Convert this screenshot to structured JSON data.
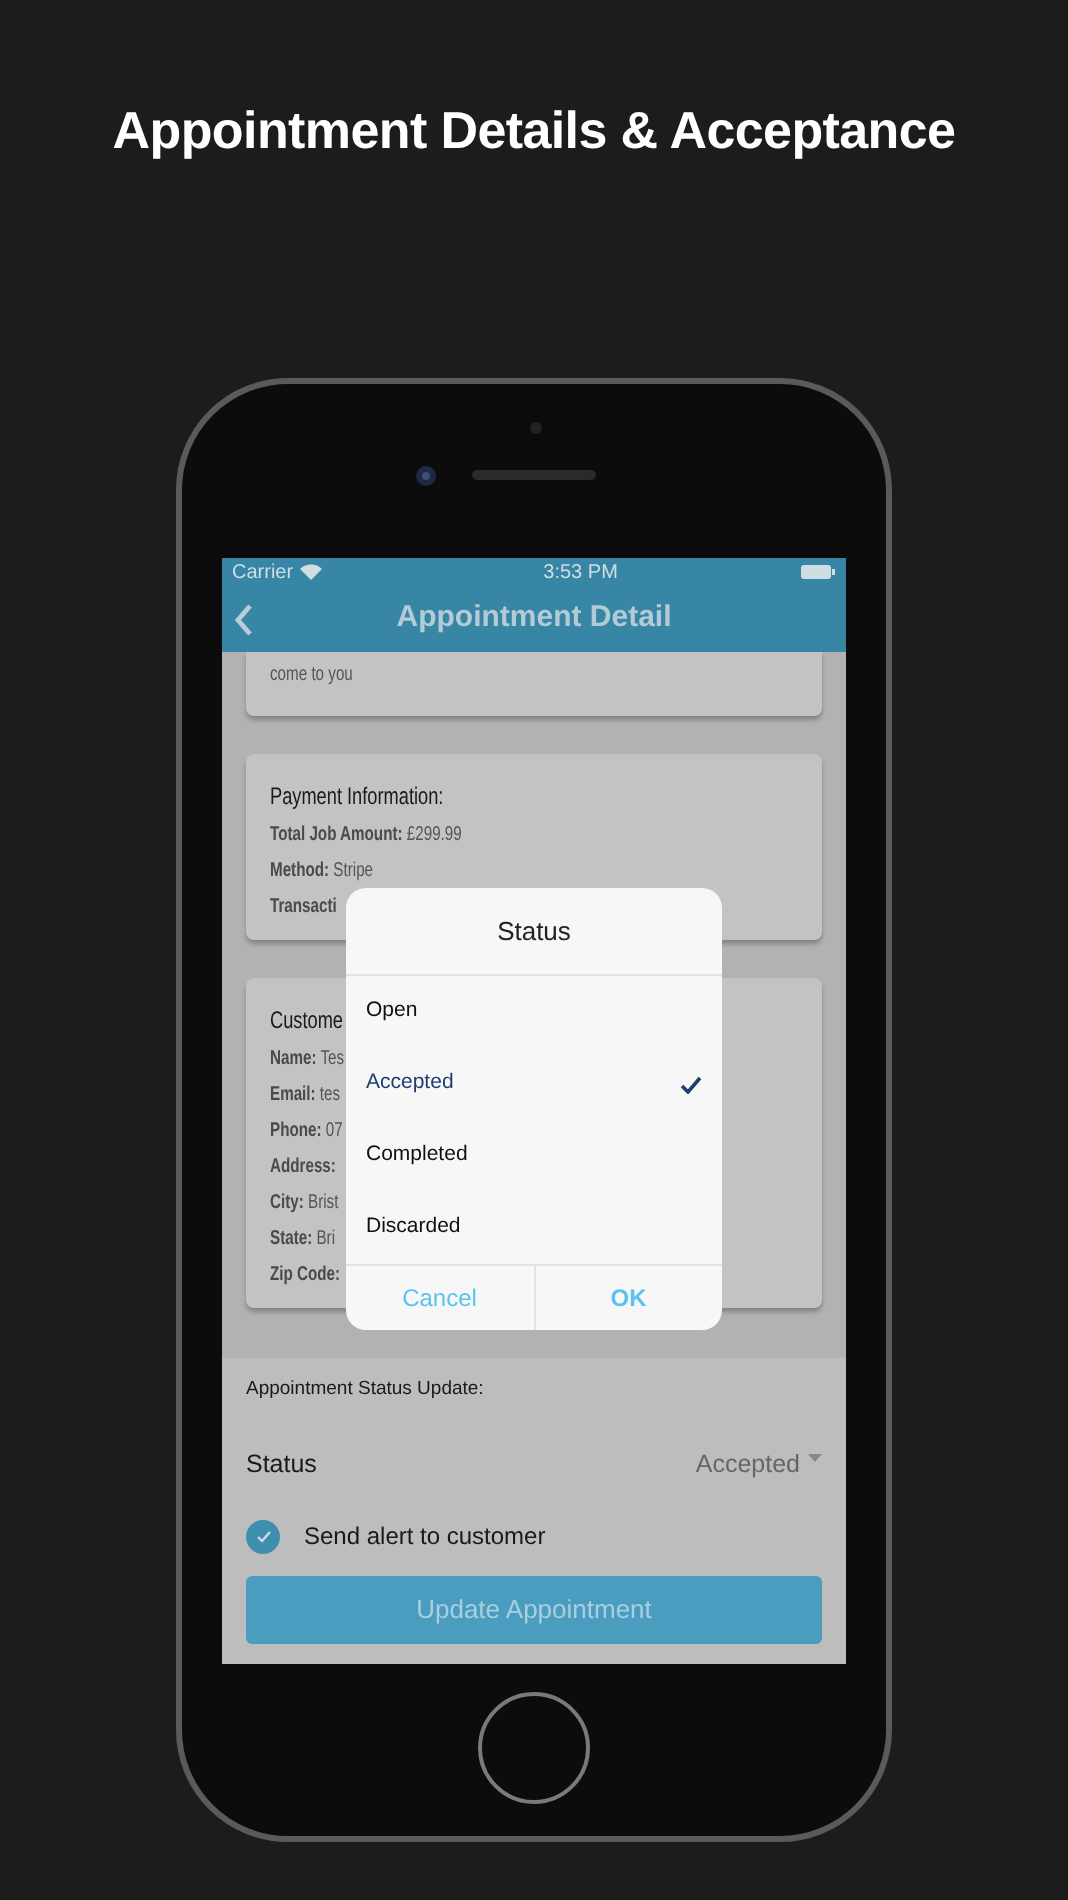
{
  "screen_title": "Appointment Details & Acceptance",
  "status_bar": {
    "carrier": "Carrier",
    "time": "3:53 PM"
  },
  "nav": {
    "title": "Appointment Detail"
  },
  "cards": [
    {
      "lines": [
        {
          "value": "come to you"
        }
      ]
    },
    {
      "heading": "Payment Information:",
      "lines": [
        {
          "label": "Total Job Amount:",
          "value": "£299.99"
        },
        {
          "label": "Method:",
          "value": "Stripe"
        },
        {
          "label": "Transacti"
        }
      ]
    },
    {
      "heading": "Custome",
      "lines": [
        {
          "label": "Name:",
          "value": "Tes"
        },
        {
          "label": "Email:",
          "value": "tes"
        },
        {
          "label": "Phone:",
          "value": "07"
        },
        {
          "label": "Address:"
        },
        {
          "label": "City:",
          "value": "Brist"
        },
        {
          "label": "State:",
          "value": "Bri"
        },
        {
          "label": "Zip Code:"
        }
      ]
    }
  ],
  "dialog": {
    "title": "Status",
    "options": [
      {
        "label": "Open",
        "selected": false
      },
      {
        "label": "Accepted",
        "selected": true
      },
      {
        "label": "Completed",
        "selected": false
      },
      {
        "label": "Discarded",
        "selected": false
      }
    ],
    "buttons": [
      {
        "label": "Cancel",
        "kind": "cancel"
      },
      {
        "label": "OK",
        "kind": "ok"
      }
    ]
  },
  "status_update": {
    "heading": "Appointment Status Update:",
    "status_label": "Status",
    "status_value": "Accepted",
    "alert": {
      "label": "Send alert to customer",
      "checked": true
    },
    "button": "Update Appointment"
  }
}
